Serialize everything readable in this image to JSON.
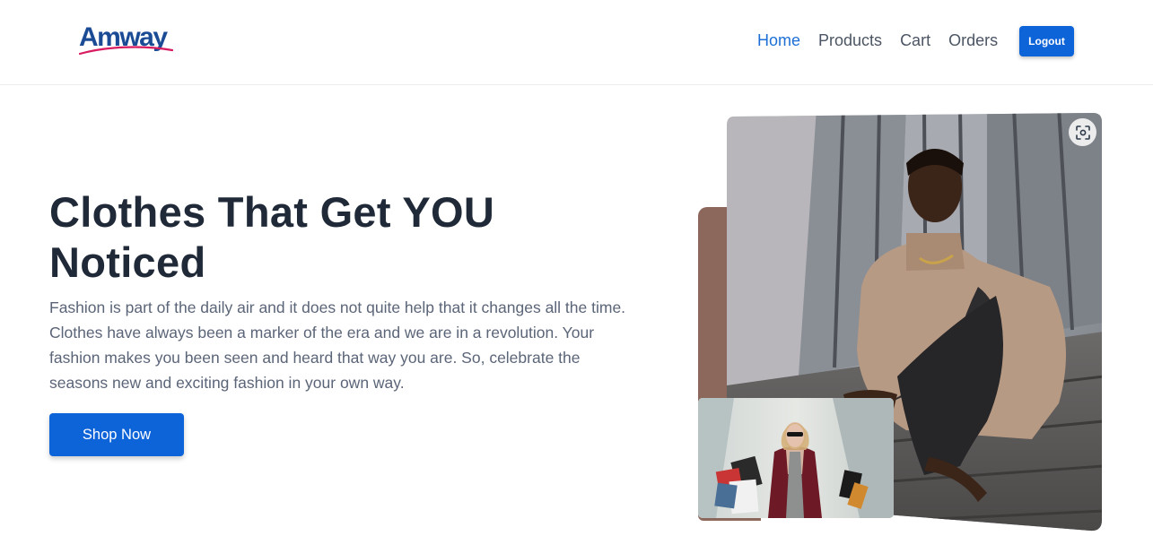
{
  "brand": {
    "logo_text": "Amway",
    "primary_color": "#0d63d8",
    "logo_color": "#1b4b95",
    "swoosh_color": "#d81b60"
  },
  "nav": {
    "links": [
      {
        "label": "Home",
        "active": true
      },
      {
        "label": "Products",
        "active": false
      },
      {
        "label": "Cart",
        "active": false
      },
      {
        "label": "Orders",
        "active": false
      }
    ],
    "logout_label": "Logout"
  },
  "hero": {
    "title": "Clothes That Get YOU Noticed",
    "description": "Fashion is part of the daily air and it does not quite help that it changes all the time. Clothes have always been a marker of the era and we are in a revolution. Your fashion makes you been seen and heard that way you are. So, celebrate the seasons new and exciting fashion in your own way.",
    "cta_label": "Shop Now"
  },
  "images": {
    "main": "man-in-turtleneck-sitting-on-stairs",
    "secondary": "woman-with-shopping-bags",
    "scan_icon": "visual-search-icon"
  }
}
